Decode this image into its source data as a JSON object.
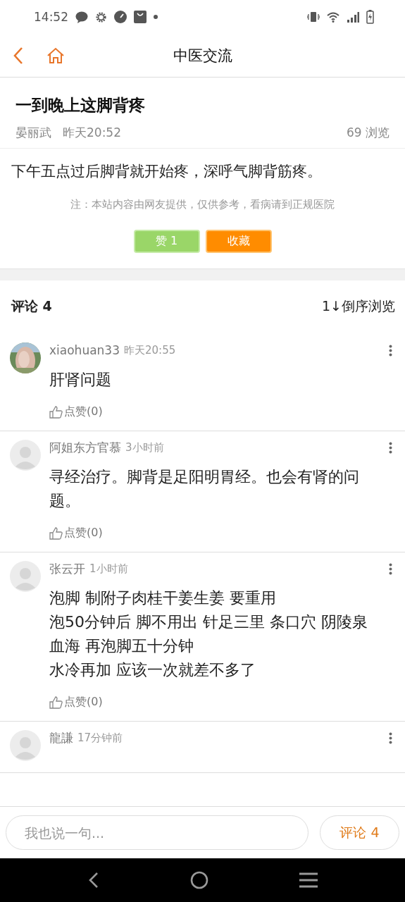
{
  "status_bar": {
    "time": "14:52"
  },
  "header": {
    "title": "中医交流"
  },
  "post": {
    "title": "一到晚上这脚背疼",
    "author": "晏丽武",
    "time": "昨天20:52",
    "views": "69 浏览",
    "body": "下午五点过后脚背就开始疼，深呼气脚背筋疼。",
    "note": "注：本站内容由网友提供，仅供参考，看病请到正规医院"
  },
  "actions": [
    {
      "kind": "like",
      "label": "赞 1"
    },
    {
      "kind": "favorite",
      "label": "收藏"
    }
  ],
  "comments_header": {
    "title": "评论 4",
    "sort": "1↓倒序浏览"
  },
  "comments": [
    {
      "photo": true,
      "user": "xiaohuan33",
      "time": "昨天20:55",
      "lines": [
        "肝肾问题"
      ],
      "like": "点赞(0)"
    },
    {
      "photo": false,
      "user": "阿姐东方官慕",
      "time": "3小时前",
      "lines": [
        "寻经治疗。脚背是足阳明胃经。也会有肾的问题。"
      ],
      "like": "点赞(0)"
    },
    {
      "photo": false,
      "user": "张云开",
      "time": "1小时前",
      "lines": [
        "泡脚 制附子肉桂干姜生姜 要重用",
        "泡50分钟后 脚不用出 针足三里 条口穴 阴陵泉血海 再泡脚五十分钟",
        "水冷再加 应该一次就差不多了"
      ],
      "like": "点赞(0)"
    },
    {
      "photo": false,
      "user": "龍謙",
      "time": "17分钟前"
    }
  ],
  "bottom_bar": {
    "placeholder": "我也说一句...",
    "button": "评论 4"
  }
}
